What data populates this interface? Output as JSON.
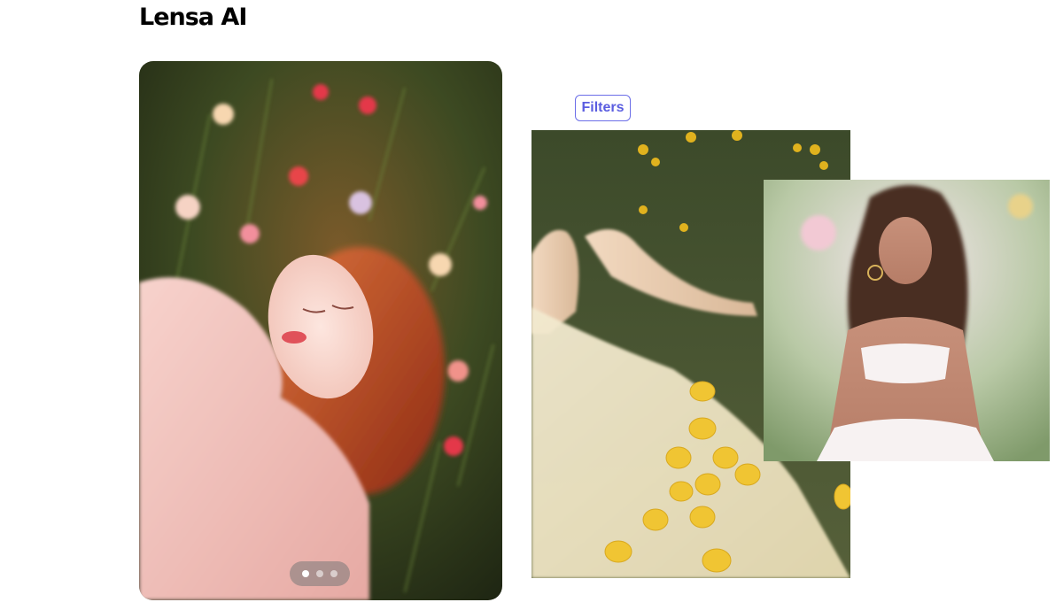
{
  "header": {
    "brand_title": "Lensa AI"
  },
  "showcase": {
    "filters_label": "Filters",
    "carousel": {
      "slide_count": 3,
      "active_index": 0
    }
  },
  "colors": {
    "badge_accent": "#6b6ee8",
    "badge_text": "#5a5de0"
  }
}
